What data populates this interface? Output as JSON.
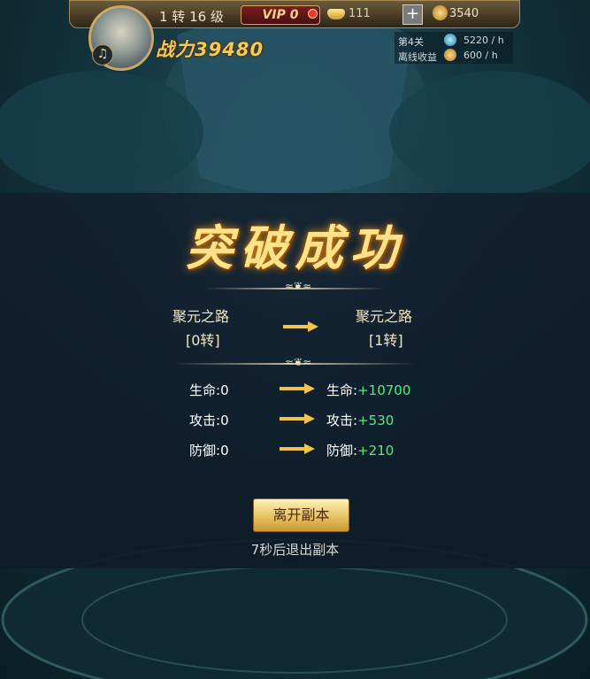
{
  "hud": {
    "level_text": "1 转 16 级",
    "vip_label": "VIP 0",
    "gold_value": "111",
    "add_label": "+",
    "coin_value": "3540",
    "power_label": "战力39480",
    "music_icon": "music-note-icon",
    "stage_label": "第4关",
    "stage_rate": "5220 / h",
    "offline_label": "离线收益",
    "offline_rate": "600 / h"
  },
  "modal": {
    "title": "突破成功",
    "from_name": "聚元之路",
    "from_level": "[0转]",
    "to_name": "聚元之路",
    "to_level": "[1转]",
    "stats": [
      {
        "label": "生命",
        "from": "0",
        "to_label": "生命",
        "to": "+10700"
      },
      {
        "label": "攻击",
        "from": "0",
        "to_label": "攻击",
        "to": "+530"
      },
      {
        "label": "防御",
        "from": "0",
        "to_label": "防御",
        "to": "+210"
      }
    ],
    "leave_button": "离开副本",
    "countdown": "7秒后退出副本"
  },
  "colors": {
    "accent_gold": "#ffe28a",
    "gain_green": "#4df07a",
    "overlay": "#121e2d"
  }
}
